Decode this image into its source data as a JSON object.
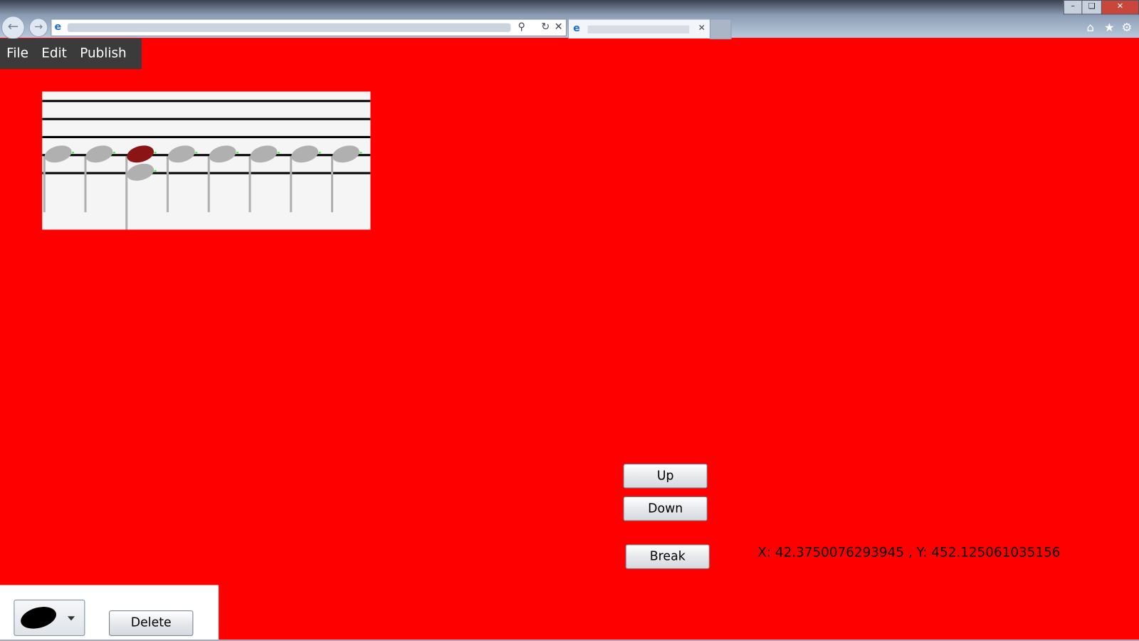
{
  "browser": {
    "icons": [
      "back-icon",
      "forward-icon",
      "ie-logo-icon",
      "search-icon",
      "refresh-icon",
      "stop-icon",
      "home-icon",
      "favorites-star-icon",
      "gear-icon"
    ],
    "window_controls": [
      "minimize",
      "restore",
      "close"
    ]
  },
  "menu": {
    "items": [
      {
        "label": "File"
      },
      {
        "label": "Edit"
      },
      {
        "label": "Publish"
      }
    ]
  },
  "staff": {
    "line_count": 5,
    "notes": [
      {
        "index": 1,
        "selected": false,
        "stacked": false
      },
      {
        "index": 2,
        "selected": false,
        "stacked": false
      },
      {
        "index": 3,
        "selected": true,
        "stacked": true
      },
      {
        "index": 4,
        "selected": false,
        "stacked": false
      },
      {
        "index": 5,
        "selected": false,
        "stacked": false
      },
      {
        "index": 6,
        "selected": false,
        "stacked": false
      },
      {
        "index": 7,
        "selected": false,
        "stacked": false
      },
      {
        "index": 8,
        "selected": false,
        "stacked": false
      }
    ],
    "colors": {
      "note": "#b0b0b0",
      "selected_note": "#8b1414",
      "staff_line": "#000000",
      "background": "#f5f5f5"
    }
  },
  "controls": {
    "up_label": "Up",
    "down_label": "Down",
    "break_label": "Break",
    "delete_label": "Delete"
  },
  "status": {
    "coordinates": "X: 42.3750076293945 , Y: 452.125061035156"
  },
  "note_selector": {
    "selected": "filled-note-head"
  },
  "colors": {
    "canvas_background": "#ff0000"
  }
}
